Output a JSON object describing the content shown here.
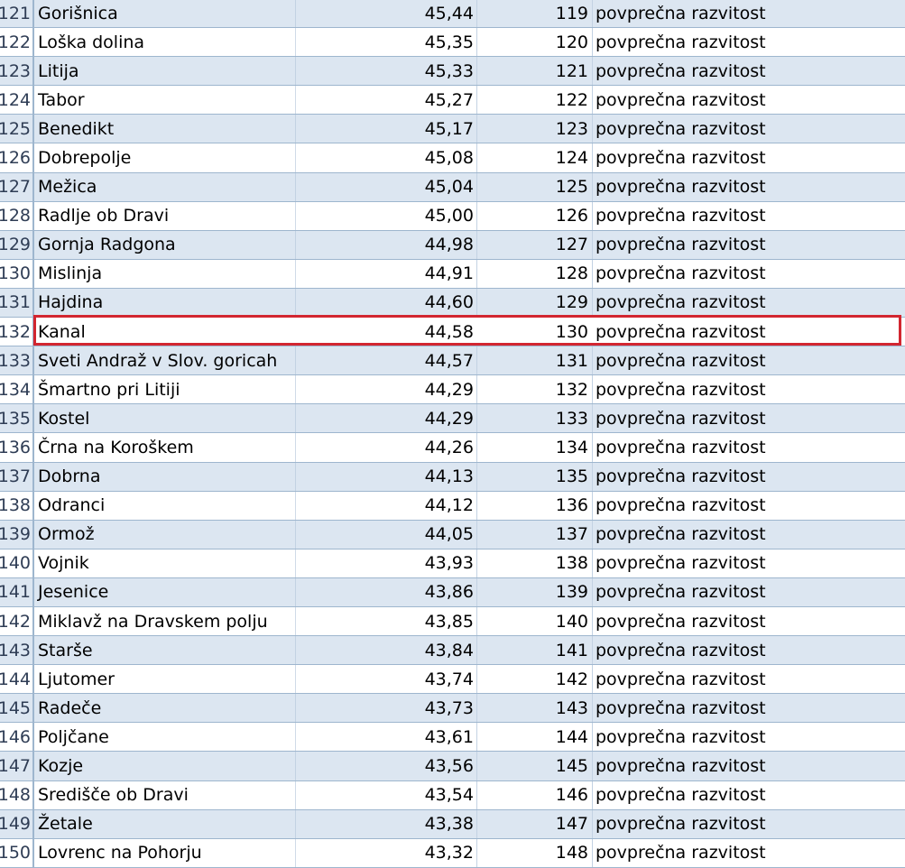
{
  "table": {
    "rows": [
      {
        "num": "121",
        "name": "Gorišnica",
        "score": "45,44",
        "rank": "119",
        "category": "povprečna razvitost"
      },
      {
        "num": "122",
        "name": "Loška dolina",
        "score": "45,35",
        "rank": "120",
        "category": "povprečna razvitost"
      },
      {
        "num": "123",
        "name": "Litija",
        "score": "45,33",
        "rank": "121",
        "category": "povprečna razvitost"
      },
      {
        "num": "124",
        "name": "Tabor",
        "score": "45,27",
        "rank": "122",
        "category": "povprečna razvitost"
      },
      {
        "num": "125",
        "name": "Benedikt",
        "score": "45,17",
        "rank": "123",
        "category": "povprečna razvitost"
      },
      {
        "num": "126",
        "name": "Dobrepolje",
        "score": "45,08",
        "rank": "124",
        "category": "povprečna razvitost"
      },
      {
        "num": "127",
        "name": "Mežica",
        "score": "45,04",
        "rank": "125",
        "category": "povprečna razvitost"
      },
      {
        "num": "128",
        "name": "Radlje ob Dravi",
        "score": "45,00",
        "rank": "126",
        "category": "povprečna razvitost"
      },
      {
        "num": "129",
        "name": "Gornja Radgona",
        "score": "44,98",
        "rank": "127",
        "category": "povprečna razvitost"
      },
      {
        "num": "130",
        "name": "Mislinja",
        "score": "44,91",
        "rank": "128",
        "category": "povprečna razvitost"
      },
      {
        "num": "131",
        "name": "Hajdina",
        "score": "44,60",
        "rank": "129",
        "category": "povprečna razvitost"
      },
      {
        "num": "132",
        "name": "Kanal",
        "score": "44,58",
        "rank": "130",
        "category": "povprečna razvitost"
      },
      {
        "num": "133",
        "name": "Sveti Andraž v Slov. goricah",
        "score": "44,57",
        "rank": "131",
        "category": "povprečna razvitost"
      },
      {
        "num": "134",
        "name": "Šmartno pri Litiji",
        "score": "44,29",
        "rank": "132",
        "category": "povprečna razvitost"
      },
      {
        "num": "135",
        "name": "Kostel",
        "score": "44,29",
        "rank": "133",
        "category": "povprečna razvitost"
      },
      {
        "num": "136",
        "name": "Črna na Koroškem",
        "score": "44,26",
        "rank": "134",
        "category": "povprečna razvitost"
      },
      {
        "num": "137",
        "name": "Dobrna",
        "score": "44,13",
        "rank": "135",
        "category": "povprečna razvitost"
      },
      {
        "num": "138",
        "name": "Odranci",
        "score": "44,12",
        "rank": "136",
        "category": "povprečna razvitost"
      },
      {
        "num": "139",
        "name": "Ormož",
        "score": "44,05",
        "rank": "137",
        "category": "povprečna razvitost"
      },
      {
        "num": "140",
        "name": "Vojnik",
        "score": "43,93",
        "rank": "138",
        "category": "povprečna razvitost"
      },
      {
        "num": "141",
        "name": "Jesenice",
        "score": "43,86",
        "rank": "139",
        "category": "povprečna razvitost"
      },
      {
        "num": "142",
        "name": "Miklavž na Dravskem polju",
        "score": "43,85",
        "rank": "140",
        "category": "povprečna razvitost"
      },
      {
        "num": "143",
        "name": "Starše",
        "score": "43,84",
        "rank": "141",
        "category": "povprečna razvitost"
      },
      {
        "num": "144",
        "name": "Ljutomer",
        "score": "43,74",
        "rank": "142",
        "category": "povprečna razvitost"
      },
      {
        "num": "145",
        "name": "Radeče",
        "score": "43,73",
        "rank": "143",
        "category": "povprečna razvitost"
      },
      {
        "num": "146",
        "name": "Poljčane",
        "score": "43,61",
        "rank": "144",
        "category": "povprečna razvitost"
      },
      {
        "num": "147",
        "name": "Kozje",
        "score": "43,56",
        "rank": "145",
        "category": "povprečna razvitost"
      },
      {
        "num": "148",
        "name": "Središče ob Dravi",
        "score": "43,54",
        "rank": "146",
        "category": "povprečna razvitost"
      },
      {
        "num": "149",
        "name": "Žetale",
        "score": "43,38",
        "rank": "147",
        "category": "povprečna razvitost"
      },
      {
        "num": "150",
        "name": "Lovrenc na Pohorju",
        "score": "43,32",
        "rank": "148",
        "category": "povprečna razvitost"
      }
    ],
    "highlighted_row": "132"
  },
  "colors": {
    "band_row": "#dce6f1",
    "plain_row": "#ffffff",
    "grid_line": "#9eb6ce",
    "highlight_border": "#d22630"
  }
}
